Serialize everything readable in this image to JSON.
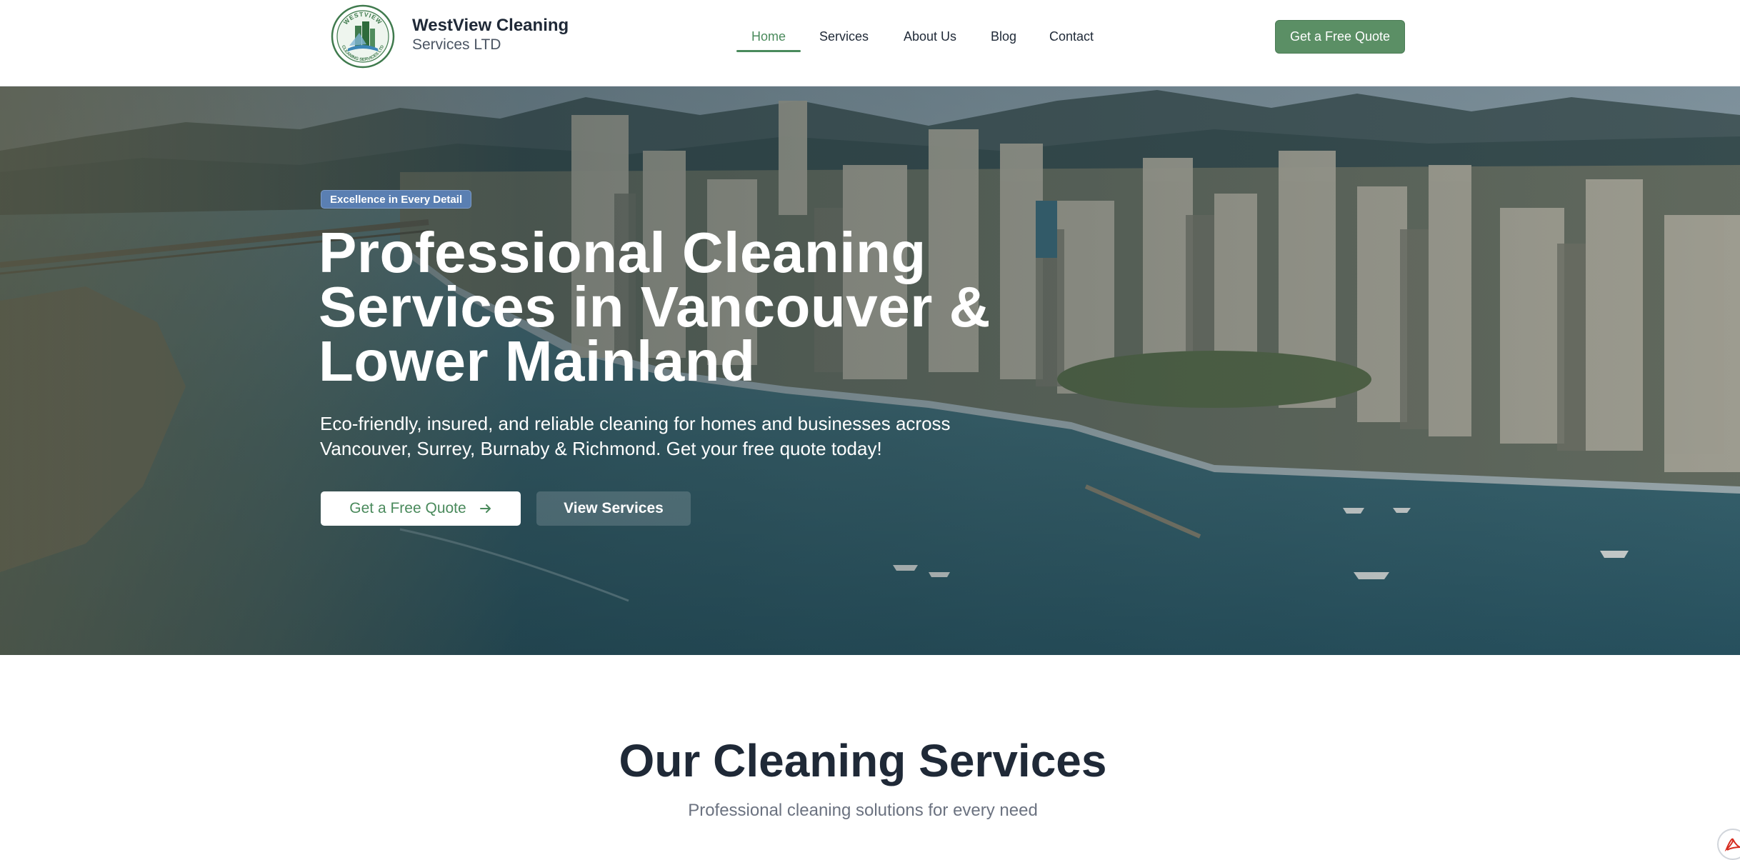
{
  "brand": {
    "name": "WestView Cleaning",
    "subtitle": "Services LTD",
    "logo_top_text": "WESTVIEW",
    "logo_bottom_text": "CLEANING SERVICES LTD"
  },
  "nav": {
    "items": [
      {
        "label": "Home",
        "active": true
      },
      {
        "label": "Services",
        "active": false
      },
      {
        "label": "About Us",
        "active": false
      },
      {
        "label": "Blog",
        "active": false
      },
      {
        "label": "Contact",
        "active": false
      }
    ],
    "cta_label": "Get a Free Quote"
  },
  "hero": {
    "badge": "Excellence in Every Detail",
    "title_lines": [
      "Professional Cleaning",
      "Services in Vancouver &",
      "Lower Mainland"
    ],
    "description_lines": [
      "Eco-friendly, insured, and reliable cleaning for homes and businesses across",
      "Vancouver, Surrey, Burnaby & Richmond. Get your free quote today!"
    ],
    "primary_button": "Get a Free Quote",
    "primary_button_icon": "arrow-right-icon",
    "secondary_button": "View Services"
  },
  "services_section": {
    "title": "Our Cleaning Services",
    "subtitle": "Professional cleaning solutions for every need"
  },
  "colors": {
    "accent_green": "#5b8f65",
    "active_nav_green": "#4a8a5c",
    "badge_blue": "#5a7fb2",
    "heading_dark": "#1f2937",
    "muted_gray": "#6b7280"
  },
  "icons": {
    "logo": "westview-logo-icon",
    "pdf_widget": "pdf-icon"
  }
}
